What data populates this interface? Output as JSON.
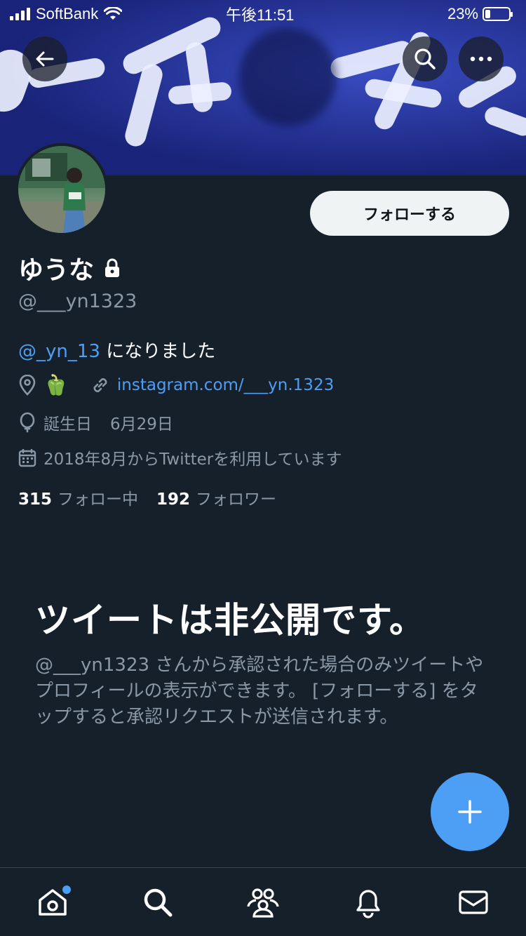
{
  "status_bar": {
    "carrier": "SoftBank",
    "time": "午後11:51",
    "battery": "23%",
    "battery_level": 0.23
  },
  "profile": {
    "name": "ゆうな",
    "handle": "@___yn1323",
    "bio_mention": "@_yn_13",
    "bio_text": " になりました",
    "location_emoji": "🫑",
    "website": "instagram.com/___yn.1323",
    "birthday_label": "誕生日",
    "birthday": "6月29日",
    "joined": "2018年8月からTwitterを利用しています",
    "following_count": "315",
    "following_label": "フォロー中",
    "followers_count": "192",
    "followers_label": "フォロワー"
  },
  "actions": {
    "follow_label": "フォローする"
  },
  "private_notice": {
    "title": "ツイートは非公開です。",
    "description": "@___yn1323 さんから承認された場合のみツイートやプロフィールの表示ができます。 [フォローする] をタップすると承認リクエストが送信されます。"
  },
  "icons": {
    "back": "arrow-left-icon",
    "search": "search-icon",
    "more": "more-icon",
    "lock": "lock-icon",
    "location": "location-pin-icon",
    "link": "link-icon",
    "birthday": "balloon-icon",
    "calendar": "calendar-icon",
    "compose": "plus-icon",
    "tabs": [
      "home-icon",
      "search-icon",
      "communities-icon",
      "bell-icon",
      "mail-icon"
    ]
  },
  "colors": {
    "background": "#15202b",
    "accent": "#4d9ff5",
    "secondary_text": "#8b98a5",
    "follow_button_bg": "#eff3f4"
  }
}
